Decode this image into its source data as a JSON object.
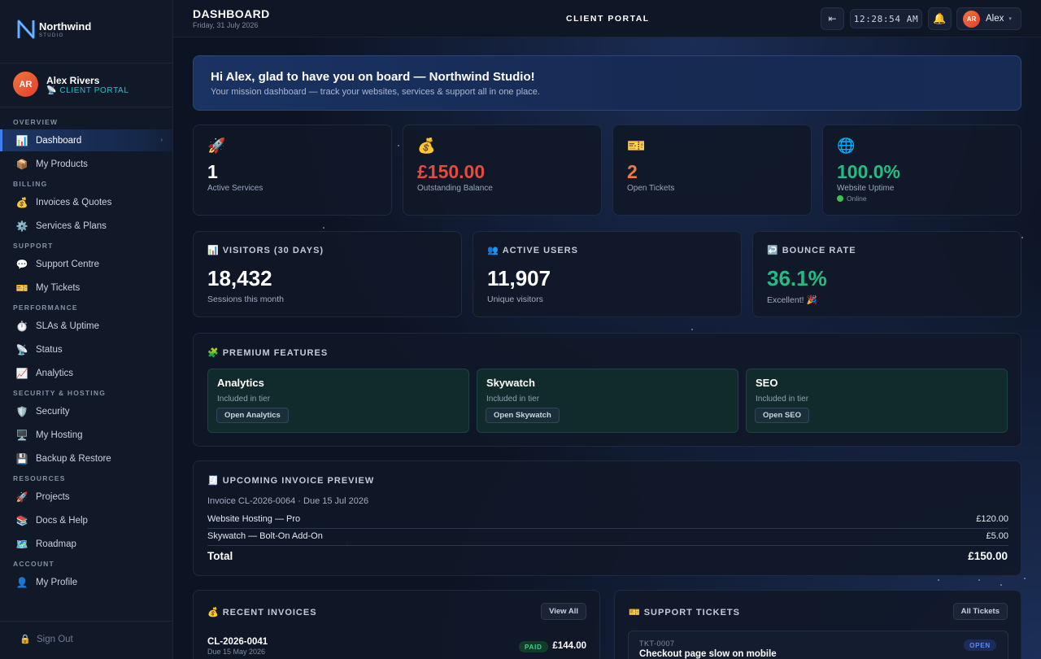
{
  "colors": {
    "accent": "#3f7cf0",
    "danger": "#e64a3c",
    "warning": "#f07a38",
    "success": "#1fbf83",
    "brand_teal": "#22c2c8"
  },
  "brand": {
    "name": "Northwind",
    "sub": "STUDIO",
    "logo_icon": "n-logo-icon"
  },
  "user": {
    "initials": "AR",
    "name": "Alex Rivers",
    "role": "📡 CLIENT PORTAL"
  },
  "sidebar": {
    "sections": [
      {
        "title": "OVERVIEW",
        "items": [
          {
            "icon": "📊",
            "label": "Dashboard",
            "active": true
          },
          {
            "icon": "📦",
            "label": "My Products"
          }
        ]
      },
      {
        "title": "BILLING",
        "items": [
          {
            "icon": "💰",
            "label": "Invoices & Quotes"
          },
          {
            "icon": "⚙️",
            "label": "Services & Plans"
          }
        ]
      },
      {
        "title": "SUPPORT",
        "items": [
          {
            "icon": "💬",
            "label": "Support Centre"
          },
          {
            "icon": "🎫",
            "label": "My Tickets"
          }
        ]
      },
      {
        "title": "PERFORMANCE",
        "items": [
          {
            "icon": "⏱️",
            "label": "SLAs & Uptime"
          },
          {
            "icon": "📡",
            "label": "Status"
          },
          {
            "icon": "📈",
            "label": "Analytics"
          }
        ]
      },
      {
        "title": "SECURITY & HOSTING",
        "items": [
          {
            "icon": "🛡️",
            "label": "Security"
          },
          {
            "icon": "🖥️",
            "label": "My Hosting"
          },
          {
            "icon": "💾",
            "label": "Backup & Restore"
          }
        ]
      },
      {
        "title": "RESOURCES",
        "items": [
          {
            "icon": "🚀",
            "label": "Projects"
          },
          {
            "icon": "📚",
            "label": "Docs & Help"
          },
          {
            "icon": "🗺️",
            "label": "Roadmap"
          }
        ]
      },
      {
        "title": "ACCOUNT",
        "items": [
          {
            "icon": "👤",
            "label": "My Profile"
          }
        ]
      }
    ],
    "signout": {
      "icon": "🔒",
      "label": "Sign Out"
    }
  },
  "topbar": {
    "title": "DASHBOARD",
    "date": "Friday, 31 July 2026",
    "portal": "CLIENT PORTAL",
    "collapse_icon": "⇤",
    "clock": "12:28:54 AM",
    "bell_icon": "🔔",
    "user_initials": "AR",
    "user_name": "Alex",
    "caret": "▾"
  },
  "welcome": {
    "title": "Hi Alex, glad to have you on board — Northwind Studio!",
    "subtitle": "Your mission dashboard — track your websites, services & support all in one place."
  },
  "stats": [
    {
      "icon": "🚀",
      "value": "1",
      "label": "Active Services",
      "color": "#ffffff"
    },
    {
      "icon": "💰",
      "value": "£150.00",
      "label": "Outstanding Balance",
      "color": "#e64a3c"
    },
    {
      "icon": "🎫",
      "value": "2",
      "label": "Open Tickets",
      "color": "#f07a38"
    },
    {
      "icon": "🌐",
      "value": "100.0%",
      "label": "Website Uptime",
      "color": "#1fbf83",
      "status": "Online"
    }
  ],
  "metrics": [
    {
      "icon": "📊",
      "title": "VISITORS (30 DAYS)",
      "value": "18,432",
      "sub": "Sessions this month",
      "color": "#ffffff"
    },
    {
      "icon": "👥",
      "title": "ACTIVE USERS",
      "value": "11,907",
      "sub": "Unique visitors",
      "color": "#ffffff"
    },
    {
      "icon": "↩️",
      "title": "BOUNCE RATE",
      "value": "36.1%",
      "sub": "Excellent! 🎉",
      "color": "#1fbf83"
    }
  ],
  "premium": {
    "icon": "🧩",
    "title": "PREMIUM FEATURES",
    "features": [
      {
        "name": "Analytics",
        "tier": "Included in tier",
        "button": "Open Analytics"
      },
      {
        "name": "Skywatch",
        "tier": "Included in tier",
        "button": "Open Skywatch"
      },
      {
        "name": "SEO",
        "tier": "Included in tier",
        "button": "Open SEO"
      }
    ]
  },
  "invoice_preview": {
    "icon": "🧾",
    "title": "UPCOMING INVOICE PREVIEW",
    "meta": "Invoice CL-2026-0064 · Due 15 Jul 2026",
    "lines": [
      {
        "desc": "Website Hosting — Pro",
        "amount": "£120.00"
      },
      {
        "desc": "Skywatch — Bolt-On Add-On",
        "amount": "£5.00"
      }
    ],
    "total_label": "Total",
    "total": "£150.00"
  },
  "recent_invoices": {
    "icon": "💰",
    "title": "RECENT INVOICES",
    "button": "View All",
    "items": [
      {
        "id": "CL-2026-0041",
        "due": "Due 15 May 2026",
        "status": "PAID",
        "amount": "£144.00"
      }
    ]
  },
  "support_tickets": {
    "icon": "🎫",
    "title": "SUPPORT TICKETS",
    "button": "All Tickets",
    "items": [
      {
        "id": "TKT-0007",
        "title": "Checkout page slow on mobile",
        "status": "OPEN"
      }
    ]
  }
}
